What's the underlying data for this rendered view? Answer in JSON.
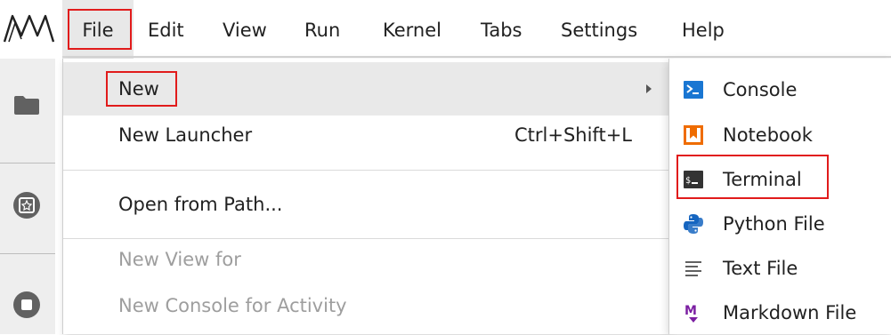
{
  "menubar": {
    "items": [
      {
        "label": "File"
      },
      {
        "label": "Edit"
      },
      {
        "label": "View"
      },
      {
        "label": "Run"
      },
      {
        "label": "Kernel"
      },
      {
        "label": "Tabs"
      },
      {
        "label": "Settings"
      },
      {
        "label": "Help"
      }
    ],
    "logo_icon": "jupyter-logo-icon"
  },
  "sidebar": {
    "icons": [
      "folder-icon",
      "running-kernels-icon",
      "stop-icon"
    ]
  },
  "file_menu": {
    "items": [
      {
        "label": "New",
        "shortcut": "",
        "has_submenu": true
      },
      {
        "label": "New Launcher",
        "shortcut": "Ctrl+Shift+L"
      },
      {
        "label": "Open from Path...",
        "shortcut": ""
      },
      {
        "label": "New View for",
        "shortcut": "",
        "disabled": true
      },
      {
        "label": "New Console for Activity",
        "shortcut": "",
        "disabled": true
      }
    ]
  },
  "new_submenu": {
    "items": [
      {
        "label": "Console",
        "icon": "console-icon"
      },
      {
        "label": "Notebook",
        "icon": "notebook-icon"
      },
      {
        "label": "Terminal",
        "icon": "terminal-icon"
      },
      {
        "label": "Python File",
        "icon": "python-icon"
      },
      {
        "label": "Text File",
        "icon": "text-file-icon"
      },
      {
        "label": "Markdown File",
        "icon": "markdown-icon"
      }
    ]
  },
  "colors": {
    "highlight_box": "#e11b1b",
    "console_icon": "#1976d2",
    "notebook_icon": "#ef6c00",
    "terminal_icon": "#333333",
    "markdown_icon": "#7b1fa2"
  }
}
